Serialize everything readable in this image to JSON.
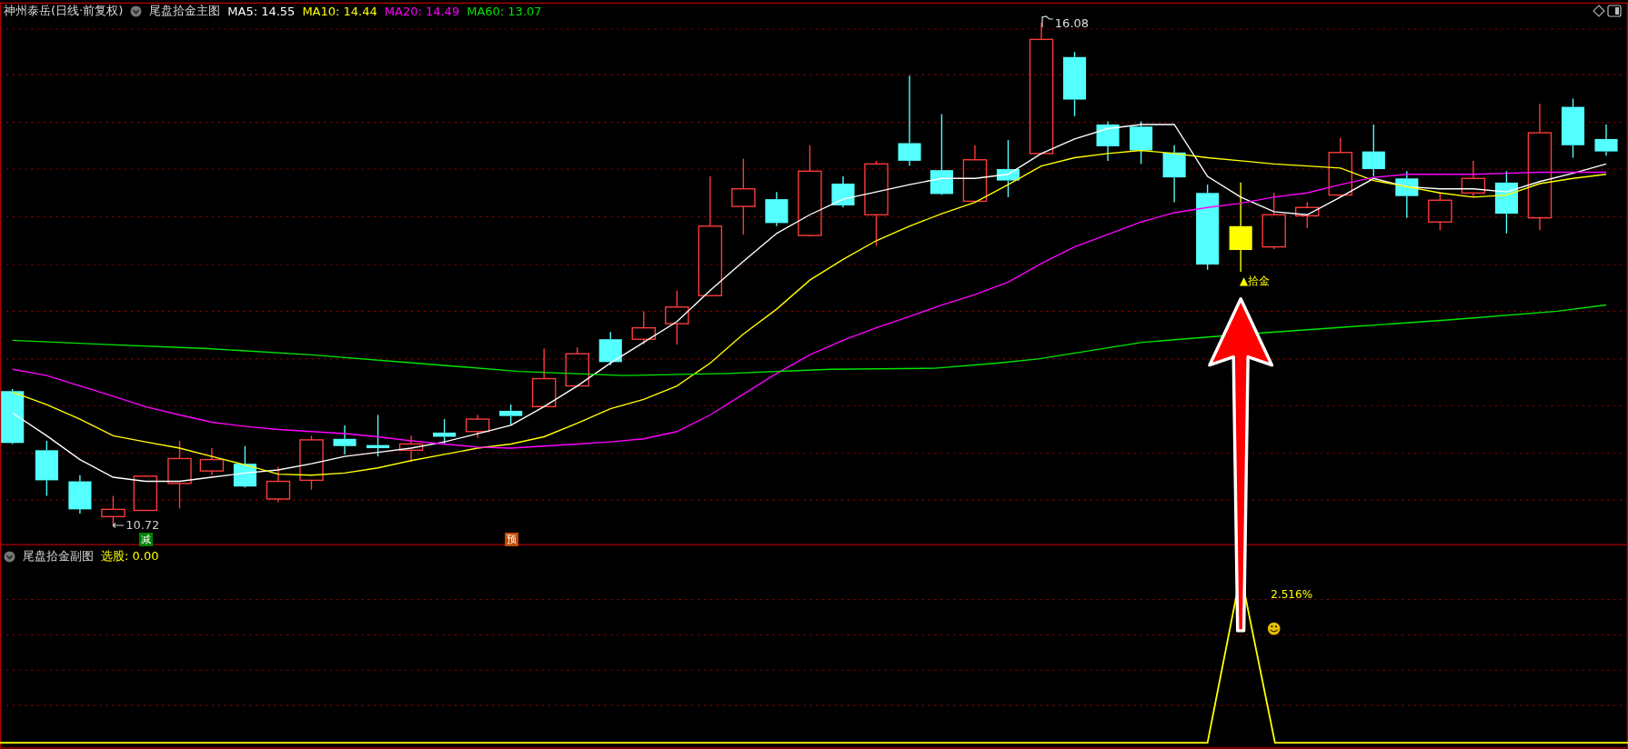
{
  "main_panel": {
    "security": "神州泰岳(日线·前复权)",
    "indicator": "尾盘拾金主图",
    "moving_averages": [
      {
        "label": "MA5: 14.55",
        "color": "#ffffff"
      },
      {
        "label": "MA10: 14.44",
        "color": "#ffff00"
      },
      {
        "label": "MA20: 14.49",
        "color": "#ff00ff"
      },
      {
        "label": "MA60: 13.07",
        "color": "#00e600"
      }
    ],
    "high_label": "16.08",
    "low_label": "10.72",
    "markers": [
      {
        "text": "减",
        "color": "#008000"
      },
      {
        "text": "预",
        "color": "#c04a00"
      }
    ],
    "signal_label": "▲拾金"
  },
  "sub_panel": {
    "indicator": "尾盘拾金副图",
    "readout": "选股: 0.00",
    "peak_label": "2.516%"
  }
}
